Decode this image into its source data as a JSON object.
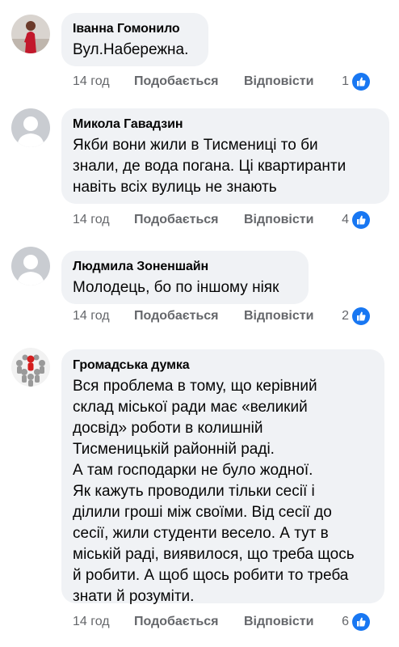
{
  "actions": {
    "like_label": "Подобається",
    "reply_label": "Відповісти"
  },
  "comments": [
    {
      "author": "Іванна Гомонило",
      "text": "Вул.Набережна.",
      "time": "14 год",
      "reactions": "1",
      "avatar": "user-photo"
    },
    {
      "author": "Микола Гавадзин",
      "text": "Якби вони жили в Тисмениці то би\nзнали, де вода погана. Ці квартиранти\nнавіть всіх вулиць не знають",
      "time": "14 год",
      "reactions": "4",
      "avatar": "default-silhouette"
    },
    {
      "author": "Людмила Зоненшайн",
      "text": "Молодець, бо по іншому ніяк",
      "time": "14 год",
      "reactions": "2",
      "avatar": "default-silhouette"
    },
    {
      "author": "Громадська думка",
      "text": "Вся проблема в тому, що керівний\nсклад міської ради має «великий\nдосвід» роботи в колишній\nТисменицькій районній раді.\nА там господарки не було жодної.\nЯк кажуть проводили тільки сесії і\nділили гроші між своїми. Від сесії до\nсесії, жили студенти весело. А тут в\nміській раді, виявилося, що треба щось\nй робити. А щоб щось робити то треба\nзнати й розуміти.",
      "time": "14 год",
      "reactions": "6",
      "avatar": "group-figures"
    }
  ],
  "colors": {
    "bubble": "#f0f2f5",
    "meta": "#65676b",
    "like_blue": "#1877f2"
  }
}
